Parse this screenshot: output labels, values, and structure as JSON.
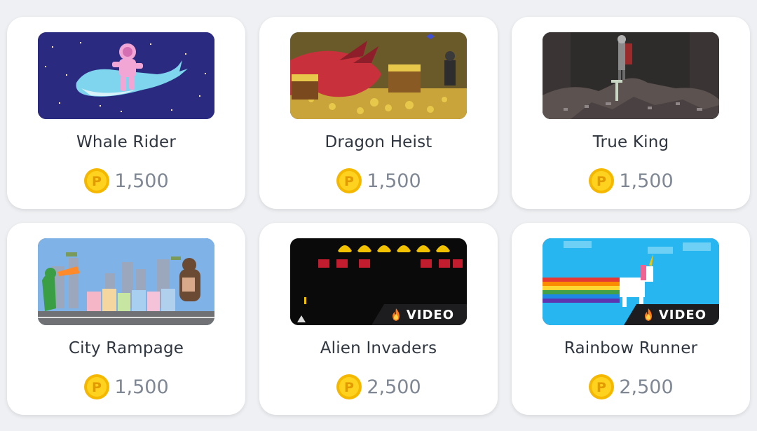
{
  "colors": {
    "background": "#eef0f3",
    "card": "#ffffff",
    "title_text": "#2f3640",
    "price_text": "#7e8793",
    "coin": "#f5c400",
    "badge": "#1d1d1f"
  },
  "games": [
    {
      "title": "Whale Rider",
      "price": "1,500",
      "thumb_icon": "whale-rider-thumbnail",
      "badge": null
    },
    {
      "title": "Dragon Heist",
      "price": "1,500",
      "thumb_icon": "dragon-heist-thumbnail",
      "badge": null
    },
    {
      "title": "True King",
      "price": "1,500",
      "thumb_icon": "true-king-thumbnail",
      "badge": null
    },
    {
      "title": "City Rampage",
      "price": "1,500",
      "thumb_icon": "city-rampage-thumbnail",
      "badge": null
    },
    {
      "title": "Alien Invaders",
      "price": "2,500",
      "thumb_icon": "alien-invaders-thumbnail",
      "badge": "VIDEO"
    },
    {
      "title": "Rainbow Runner",
      "price": "2,500",
      "thumb_icon": "rainbow-runner-thumbnail",
      "badge": "VIDEO"
    }
  ]
}
